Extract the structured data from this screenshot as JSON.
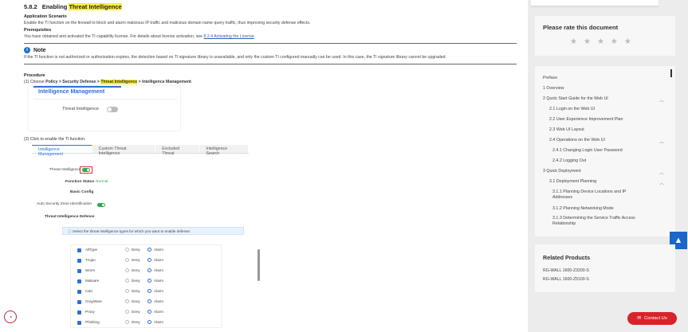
{
  "doc": {
    "section_number": "5.8.2",
    "section_title_prefix": "Enabling",
    "section_title_hl": "Threat Intelligence",
    "scenario_title": "Application Scenario",
    "scenario_text": "Enable the TI function on the firewall to block and alarm malicious IP traffic and malicious domain name query traffic, thus improving security defense effects.",
    "prereq_title": "Prerequisites",
    "prereq_text": "You have obtained and activated the TI capability license. For details about license activation, see ",
    "prereq_link": "8.2.4  Activating the License",
    "note_title": "Note",
    "note_text": "If the TI function is not authorized or authorization expires, the detection based on TI signature library is unavailable, and only the custom TI configured manually can be used. In this case, the TI signature library cannot be upgraded.",
    "procedure_title": "Procedure",
    "step1_prefix": "(1)  Choose ",
    "step1_path1": "Policy > Security Defense > ",
    "step1_path_hl": "Threat Intelligence",
    "step1_path2": " > Intelligence Management",
    "step1_end": ".",
    "shot1_title": "Intelligence Management",
    "shot1_label": "Threat Intelligence",
    "step2": "(2)  Click to enable the TI function.",
    "shot2": {
      "tabs": [
        "Intelligence Management",
        "Custom Threat Intelligence",
        "Excluded Threat",
        "Intelligence Search"
      ],
      "ti_label": "Threat Intelligence",
      "function_status_label": "Function Status",
      "function_status_value": "Normal",
      "basic_config": "Basic Config",
      "auto_zone": "Auto Security Zone Identification",
      "ti_defense": "Threat Intelligence Defense",
      "info_text": "Select the threat intelligence types for which you want to enable defense.",
      "deny": "Deny",
      "alarm": "Alarm",
      "rows": [
        "AllType",
        "Trojan",
        "Worm",
        "Malware",
        "C&C",
        "GrayWare",
        "Proxy",
        "Phishing"
      ]
    }
  },
  "sidebar": {
    "rate_title": "Please rate this document",
    "stars": [
      "★",
      "★",
      "★",
      "★",
      "★"
    ],
    "toc": [
      "Preface",
      "1 Overview",
      "2 Quick Start Guide for the Web UI",
      "2.1 Login on the Web UI",
      "2.2 User Experience Improvement Plan",
      "2.3 Web UI Layout",
      "2.4 Operations on the Web UI",
      "2.4.1 Changing Login User Password",
      "2.4.2 Logging Out",
      "3 Quick Deployment",
      "3.1 Deployment Planning",
      "3.1.1 Planning Device Locations and IP Addresses",
      "3.1.2 Planning Networking Mode",
      "3.1.3 Determining the Service Traffic Access Relationship"
    ],
    "related_title": "Related Products",
    "related": [
      "RG-WALL 1600-Z3200-S",
      "RG-WALL 1600-Z5100-S"
    ],
    "contact": "Contact Us",
    "up_arrow": "▲"
  }
}
